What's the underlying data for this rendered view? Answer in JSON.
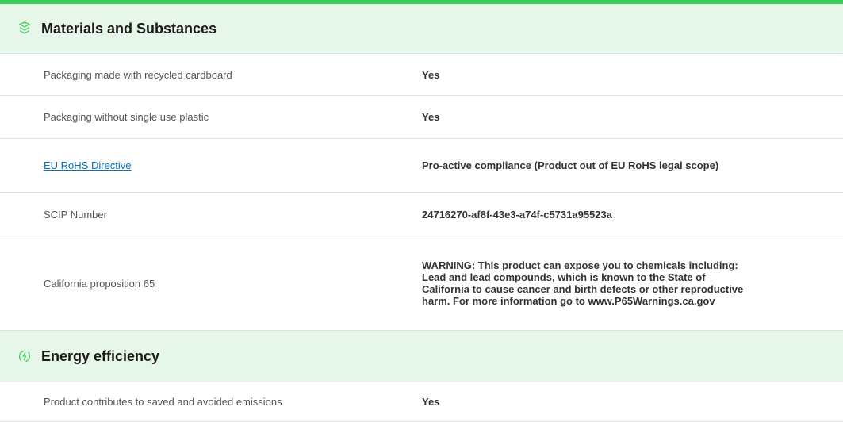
{
  "sections": [
    {
      "title": "Materials and Substances",
      "icon": "layers-icon",
      "rows": [
        {
          "label": "Packaging made with recycled cardboard",
          "value": "Yes"
        },
        {
          "label": "Packaging without single use plastic",
          "value": "Yes"
        },
        {
          "label": "EU RoHS Directive",
          "value": "Pro-active compliance (Product out of EU RoHS legal scope)"
        },
        {
          "label": "SCIP Number",
          "value": "24716270-af8f-43e3-a74f-c5731a95523a"
        },
        {
          "label": "California proposition 65",
          "value": "WARNING: This product can expose you to chemicals including: Lead and lead compounds, which is known to the State of California to cause cancer and birth defects or other reproductive harm. For more information go to www.P65Warnings.ca.gov"
        }
      ]
    },
    {
      "title": "Energy efficiency",
      "icon": "leaf-lightning-icon",
      "rows": [
        {
          "label": "Product contributes to saved and avoided emissions",
          "value": "Yes"
        }
      ]
    }
  ],
  "colors": {
    "accent": "#3dcd58",
    "header_bg": "#e6f6e9",
    "link": "#0a71b3"
  }
}
